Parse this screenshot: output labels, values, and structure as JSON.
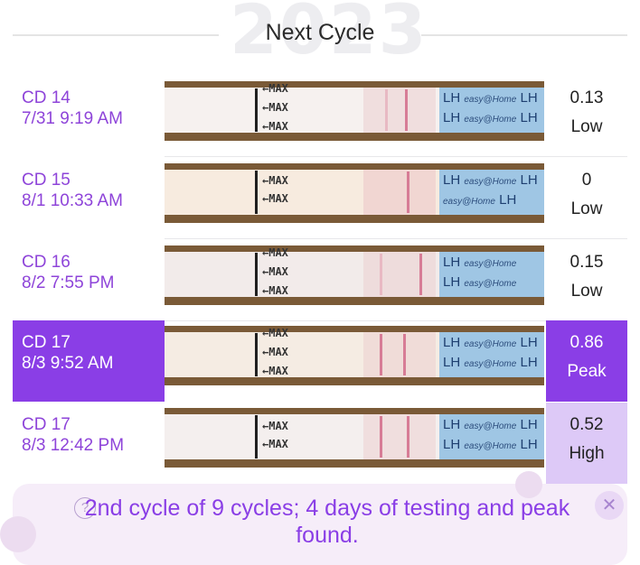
{
  "header": {
    "year_watermark": "2023",
    "title": "Next Cycle"
  },
  "strip_labels": {
    "max": "←MAX",
    "brand": "LH",
    "brand_mark": "easy@Home"
  },
  "rows": [
    {
      "cd": "CD 14",
      "datetime": "7/31 9:19 AM",
      "value": "0.13",
      "level": "Low"
    },
    {
      "cd": "CD 15",
      "datetime": "8/1 10:33 AM",
      "value": "0",
      "level": "Low"
    },
    {
      "cd": "CD 16",
      "datetime": "8/2 7:55 PM",
      "value": "0.15",
      "level": "Low"
    },
    {
      "cd": "CD 17",
      "datetime": "8/3 9:52 AM",
      "value": "0.86",
      "level": "Peak",
      "selected": true
    },
    {
      "cd": "CD 17",
      "datetime": "8/3 12:42 PM",
      "value": "0.52",
      "level": "High"
    }
  ],
  "banner": {
    "message": "2nd cycle of 9 cycles; 4 days of testing and peak found.",
    "help_icon": "question-circle-icon",
    "close_icon": "close-icon"
  },
  "colors": {
    "accent": "#8a3ee6",
    "high_bg": "#ddc9f7",
    "banner_bg": "#f6edf9"
  }
}
